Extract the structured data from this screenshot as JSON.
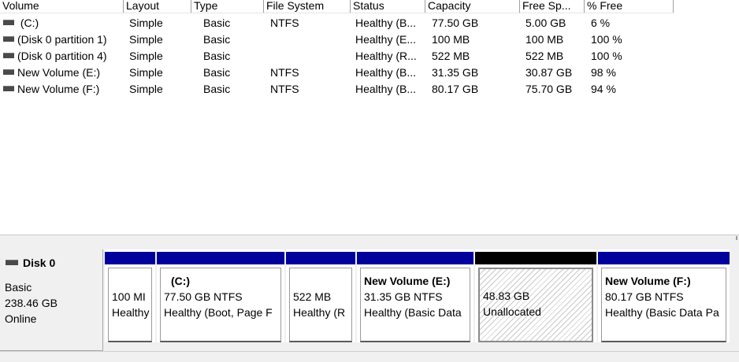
{
  "table": {
    "columns": [
      "Volume",
      "Layout",
      "Type",
      "File System",
      "Status",
      "Capacity",
      "Free Sp...",
      "% Free"
    ],
    "rows": [
      {
        "volume": " (C:)",
        "layout": "Simple",
        "type": "Basic",
        "fs": "NTFS",
        "status": "Healthy (B...",
        "capacity": "77.50 GB",
        "free": "5.00 GB",
        "pct": "6 %"
      },
      {
        "volume": "(Disk 0 partition 1)",
        "layout": "Simple",
        "type": "Basic",
        "fs": "",
        "status": "Healthy (E...",
        "capacity": "100 MB",
        "free": "100 MB",
        "pct": "100 %"
      },
      {
        "volume": "(Disk 0 partition 4)",
        "layout": "Simple",
        "type": "Basic",
        "fs": "",
        "status": "Healthy (R...",
        "capacity": "522 MB",
        "free": "522 MB",
        "pct": "100 %"
      },
      {
        "volume": "New Volume (E:)",
        "layout": "Simple",
        "type": "Basic",
        "fs": "NTFS",
        "status": "Healthy (B...",
        "capacity": "31.35 GB",
        "free": "30.87 GB",
        "pct": "98 %"
      },
      {
        "volume": "New Volume (F:)",
        "layout": "Simple",
        "type": "Basic",
        "fs": "NTFS",
        "status": "Healthy (B...",
        "capacity": "80.17 GB",
        "free": "75.70 GB",
        "pct": "94 %"
      }
    ]
  },
  "disk": {
    "name": "Disk 0",
    "type": "Basic",
    "size": "238.46 GB",
    "status": "Online"
  },
  "partitions": [
    {
      "name": "",
      "size": "100 MI",
      "status": "Healthy"
    },
    {
      "name": "(C:)",
      "size": "77.50 GB NTFS",
      "status": "Healthy (Boot, Page F"
    },
    {
      "name": "",
      "size": "522 MB",
      "status": "Healthy (R"
    },
    {
      "name": "New Volume  (E:)",
      "size": "31.35 GB NTFS",
      "status": "Healthy (Basic Data"
    },
    {
      "name": "",
      "size": "48.83 GB",
      "status": "Unallocated"
    },
    {
      "name": "New Volume  (F:)",
      "size": "80.17 GB NTFS",
      "status": "Healthy (Basic Data Pa"
    }
  ],
  "colors": {
    "primary_partition": "#00009b",
    "unallocated": "#000000"
  }
}
